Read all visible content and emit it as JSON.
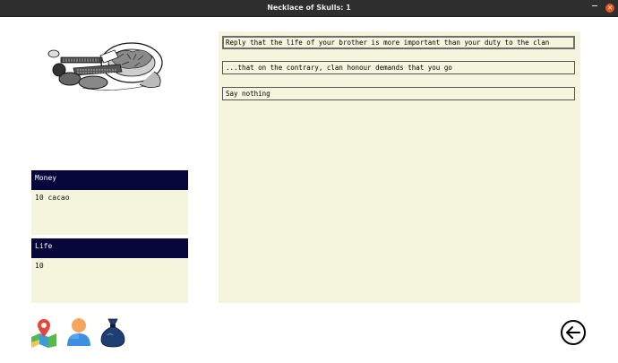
{
  "window": {
    "title": "Necklace of Skulls: 1"
  },
  "stats": [
    {
      "label": "Money",
      "value": "10 cacao"
    },
    {
      "label": "Life",
      "value": "10"
    }
  ],
  "choices": [
    {
      "label": "Reply that the life of your brother is more important than your duty to the clan",
      "selected": true
    },
    {
      "label": "...that on the contrary, clan honour demands that you go",
      "selected": false
    },
    {
      "label": "Say nothing",
      "selected": false
    }
  ],
  "icons": [
    "map-icon",
    "character-icon",
    "inventory-bag-icon",
    "back-arrow-icon"
  ],
  "colors": {
    "panel": "#f5f4dc",
    "header": "#06063a",
    "titlebar": "#2e2e2e",
    "close": "#e95420"
  }
}
